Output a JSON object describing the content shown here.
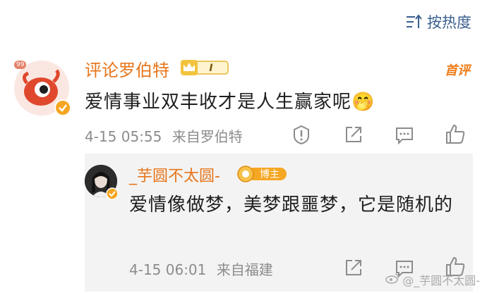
{
  "header": {
    "sort_label": "按热度"
  },
  "comment": {
    "username": "评论罗伯特",
    "level_badge": "I",
    "avatar_level": "99",
    "first_comment_tag": "首评",
    "text": "爱情事业双丰收才是人生赢家呢🤭",
    "timestamp": "4-15 05:55",
    "source": "来自罗伯特"
  },
  "reply": {
    "username": "_芋圆不太圆-",
    "author_badge": "博主",
    "text": "爱情像做梦，美梦跟噩梦，它是随机的",
    "timestamp": "4-15 06:01",
    "source": "来自福建"
  },
  "watermark": {
    "text": "@_芋圆不太圆-"
  },
  "colors": {
    "username": "#e8751a",
    "link": "#3a5f8f",
    "meta": "#8c8c8c",
    "reply_bg": "#f3f3f3"
  },
  "icons": [
    "sort-icon",
    "report-icon",
    "share-icon",
    "reply-icon",
    "like-icon",
    "verified-icon",
    "crown-icon",
    "weibo-watermark-icon"
  ]
}
